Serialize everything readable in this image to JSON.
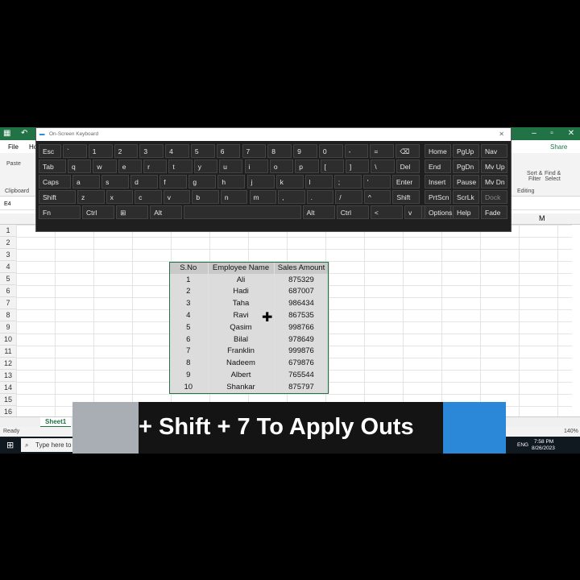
{
  "excel": {
    "ribbon_tabs": [
      "File",
      "Ho"
    ],
    "ribbon_left_labels": [
      "Paste",
      "Clipboard"
    ],
    "ribbon_right": {
      "share": "Share",
      "sort_filter": "Sort &\nFilter",
      "find_select": "Find &\nSelect",
      "editing": "Editing"
    },
    "name_box": "E4",
    "col_label": "M",
    "row_numbers": [
      "1",
      "2",
      "3",
      "4",
      "5",
      "6",
      "7",
      "8",
      "9",
      "10",
      "11",
      "12",
      "13",
      "14",
      "15",
      "16"
    ],
    "table": {
      "headers": [
        "S.No",
        "Employee Name",
        "Sales Amount"
      ],
      "rows": [
        [
          "1",
          "Ali",
          "875329"
        ],
        [
          "2",
          "Hadi",
          "687007"
        ],
        [
          "3",
          "Taha",
          "986434"
        ],
        [
          "4",
          "Ravi",
          "867535"
        ],
        [
          "5",
          "Qasim",
          "998766"
        ],
        [
          "6",
          "Bilal",
          "978649"
        ],
        [
          "7",
          "Franklin",
          "999876"
        ],
        [
          "8",
          "Nadeem",
          "679876"
        ],
        [
          "9",
          "Albert",
          "765544"
        ],
        [
          "10",
          "Shankar",
          "875797"
        ]
      ]
    },
    "sheet_tab": "Sheet1",
    "status_ready": "Ready",
    "zoom": "140%"
  },
  "taskbar": {
    "search_placeholder": "Type here to",
    "lang": "ENG",
    "time": "7:58 PM",
    "date": "8/26/2023"
  },
  "osk": {
    "title": "On-Screen Keyboard",
    "rows": [
      [
        "Esc",
        "`",
        "1",
        "2",
        "3",
        "4",
        "5",
        "6",
        "7",
        "8",
        "9",
        "0",
        "-",
        "=",
        "⌫"
      ],
      [
        "Tab",
        "q",
        "w",
        "e",
        "r",
        "t",
        "y",
        "u",
        "i",
        "o",
        "p",
        "[",
        "]",
        "\\",
        "Del"
      ],
      [
        "Caps",
        "a",
        "s",
        "d",
        "f",
        "g",
        "h",
        "j",
        "k",
        "l",
        ";",
        "'",
        "Enter"
      ],
      [
        "Shift",
        "z",
        "x",
        "c",
        "v",
        "b",
        "n",
        "m",
        ",",
        ".",
        "/",
        "^",
        "Shift"
      ],
      [
        "Fn",
        "Ctrl",
        "⊞",
        "Alt",
        "",
        "Alt",
        "Ctrl",
        "<",
        "v",
        ">",
        "▦"
      ]
    ],
    "side_keys": [
      [
        "Home",
        "PgUp",
        "Nav"
      ],
      [
        "End",
        "PgDn",
        "Mv Up"
      ],
      [
        "Insert",
        "Pause",
        "Mv Dn"
      ],
      [
        "PrtScn",
        "ScrLk",
        "Dock"
      ],
      [
        "Options",
        "Help",
        "Fade"
      ]
    ]
  },
  "caption": {
    "text": "+ Shift + 7 To Apply Outs"
  }
}
